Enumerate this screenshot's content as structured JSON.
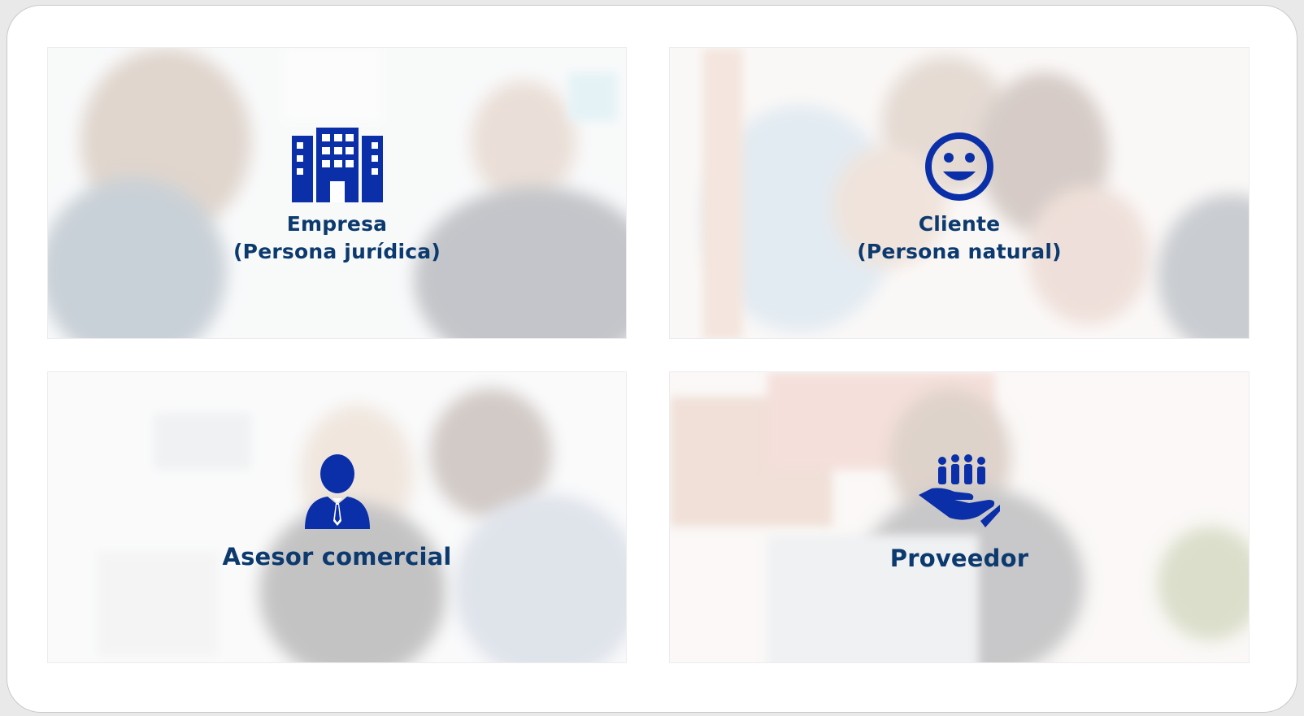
{
  "cards": [
    {
      "id": "empresa",
      "icon": "building-icon",
      "title": "Empresa",
      "subtitle": "(Persona jurídica)"
    },
    {
      "id": "cliente",
      "icon": "smiley-face-icon",
      "title": "Cliente",
      "subtitle": "(Persona natural)"
    },
    {
      "id": "asesor",
      "icon": "businessman-icon",
      "title": "Asesor comercial"
    },
    {
      "id": "proveedor",
      "icon": "hand-holding-people-icon",
      "title": "Proveedor"
    }
  ],
  "colors": {
    "icon_blue": "#0a2fa8",
    "label_navy": "#0d3a6e",
    "panel": "#ffffff",
    "backdrop": "#e9e9ea"
  }
}
